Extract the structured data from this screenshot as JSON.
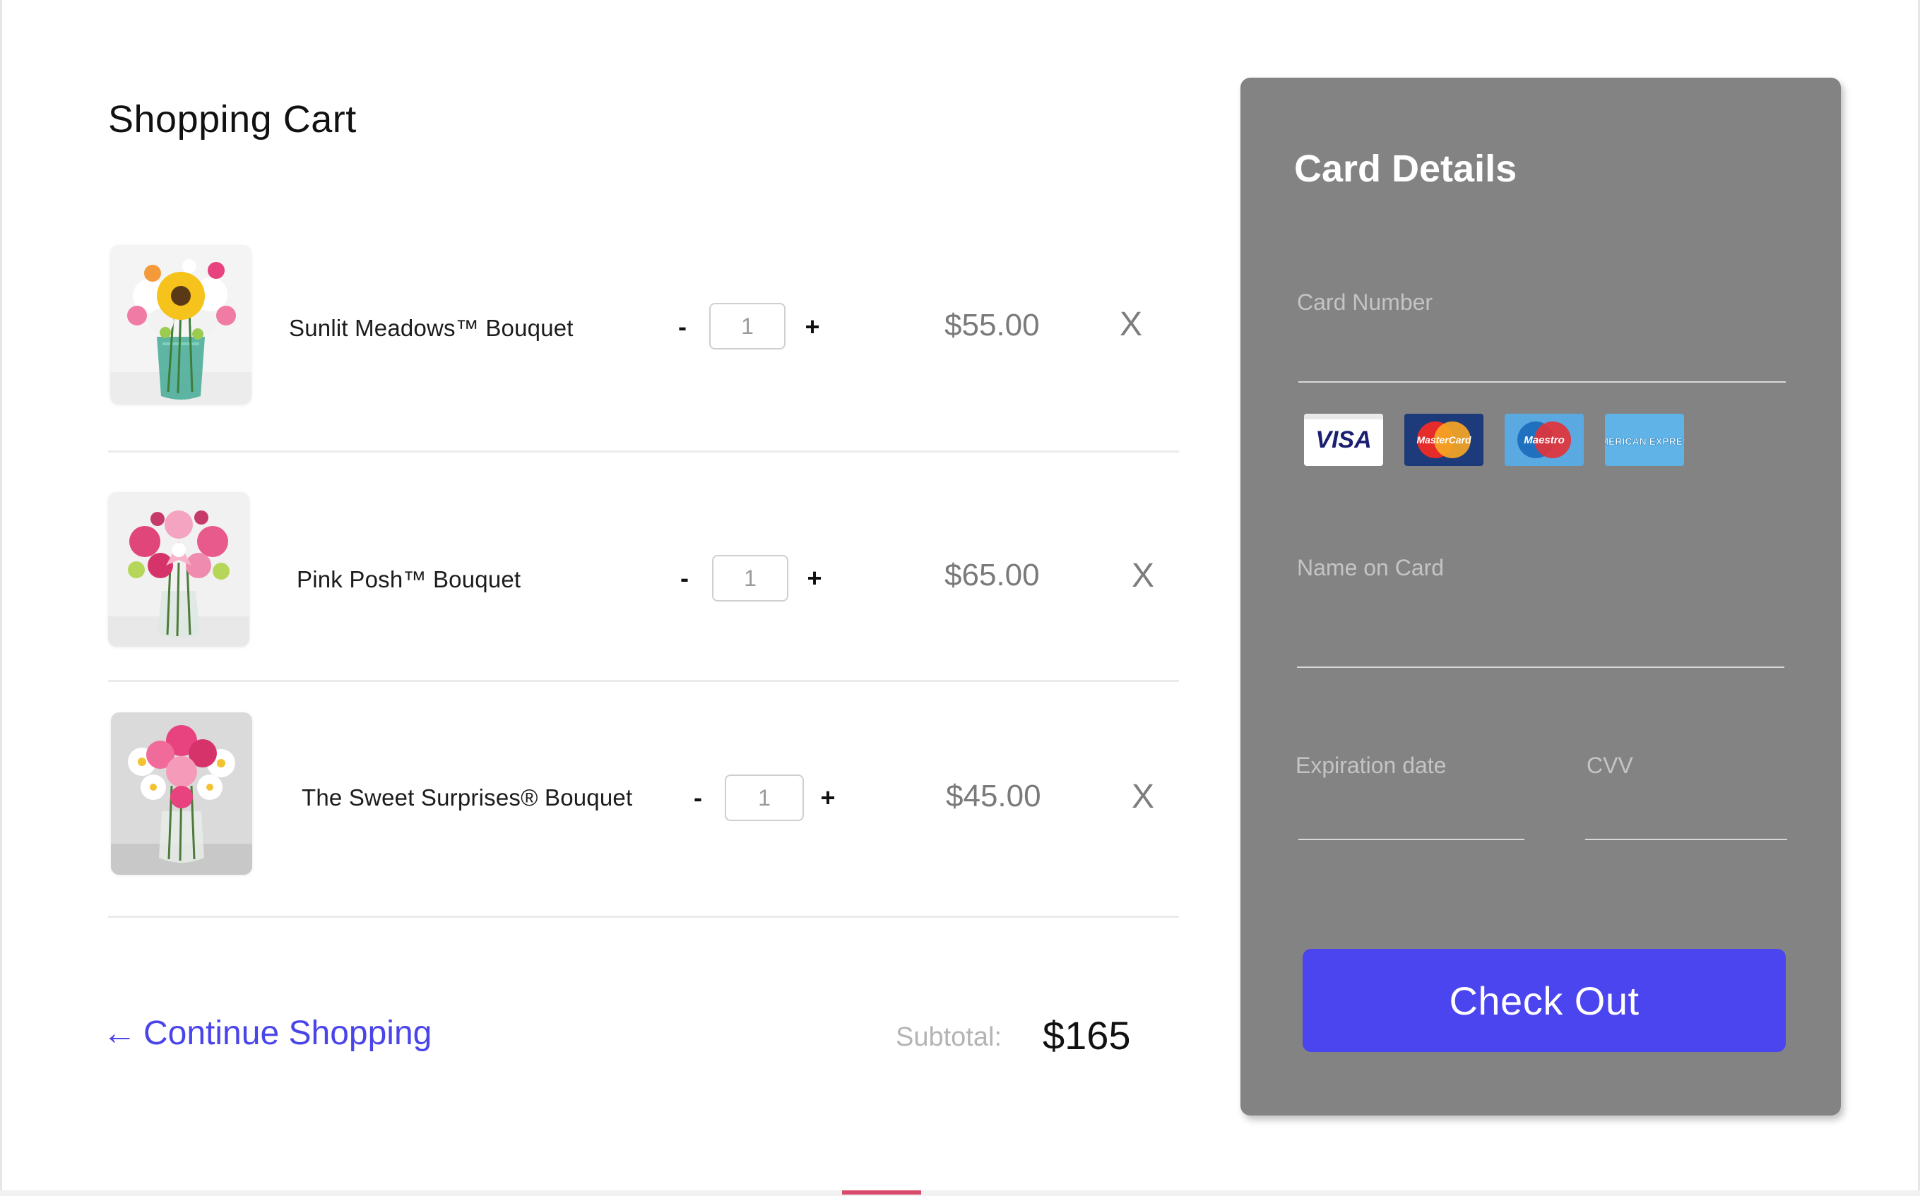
{
  "cart": {
    "title": "Shopping Cart",
    "items": [
      {
        "name": "Sunlit Meadows™ Bouquet",
        "quantity": "1",
        "price": "$55.00",
        "minus": "-",
        "plus": "+",
        "remove": "X"
      },
      {
        "name": "Pink Posh™ Bouquet",
        "quantity": "1",
        "price": "$65.00",
        "minus": "-",
        "plus": "+",
        "remove": "X"
      },
      {
        "name": "The Sweet Surprises® Bouquet",
        "quantity": "1",
        "price": "$45.00",
        "minus": "-",
        "plus": "+",
        "remove": "X"
      }
    ],
    "continue_arrow": "←",
    "continue_label": "Continue Shopping",
    "subtotal_label": "Subtotal:",
    "subtotal_value": "$165"
  },
  "card": {
    "title": "Card Details",
    "card_number_label": "Card Number",
    "name_on_card_label": "Name on Card",
    "expiration_label": "Expiration date",
    "cvv_label": "CVV",
    "logos": [
      "VISA",
      "MasterCard",
      "Maestro",
      "AMERICAN EXPRESS"
    ],
    "checkout_label": "Check Out"
  },
  "colors": {
    "accent": "#4b45ef",
    "panel": "#838383",
    "link": "#4a45ea"
  }
}
